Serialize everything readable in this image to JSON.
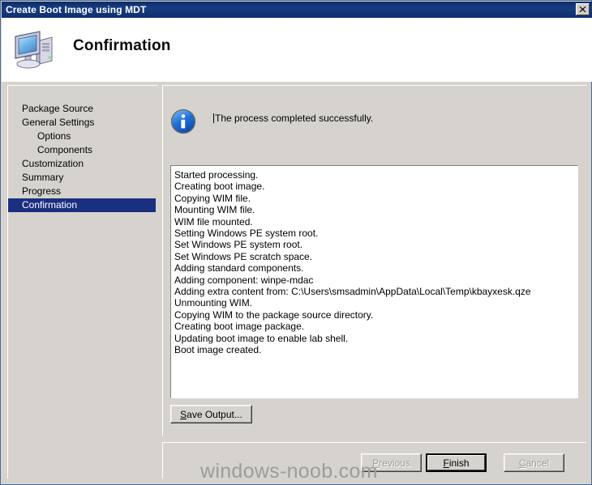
{
  "window": {
    "title": "Create Boot Image using MDT",
    "close_label": "✕"
  },
  "header": {
    "title": "Confirmation",
    "icon": "computer-icon"
  },
  "sidebar": {
    "items": [
      {
        "label": "Package Source",
        "indent": false,
        "selected": false
      },
      {
        "label": "General Settings",
        "indent": false,
        "selected": false
      },
      {
        "label": "Options",
        "indent": true,
        "selected": false
      },
      {
        "label": "Components",
        "indent": true,
        "selected": false
      },
      {
        "label": "Customization",
        "indent": false,
        "selected": false
      },
      {
        "label": "Summary",
        "indent": false,
        "selected": false
      },
      {
        "label": "Progress",
        "indent": false,
        "selected": false
      },
      {
        "label": "Confirmation",
        "indent": false,
        "selected": true
      }
    ]
  },
  "content": {
    "info_icon": "information-icon",
    "info_message": "The process completed successfully.",
    "log_lines": [
      "Started processing.",
      "Creating boot image.",
      "Copying WIM file.",
      "Mounting WIM file.",
      "WIM file mounted.",
      "Setting Windows PE system root.",
      "Set Windows PE system root.",
      "Set Windows PE scratch space.",
      "Adding standard components.",
      "Adding component: winpe-mdac",
      "Adding extra content from: C:\\Users\\smsadmin\\AppData\\Local\\Temp\\kbayxesk.qze",
      "Unmounting WIM.",
      "Copying WIM to the package source directory.",
      "Creating boot image package.",
      "Updating boot image to enable lab shell.",
      "Boot image created."
    ],
    "save_output_accel": "S",
    "save_output_rest": "ave Output..."
  },
  "footer": {
    "previous_accel": "P",
    "previous_rest": "revious",
    "finish_accel": "F",
    "finish_rest": "inish",
    "cancel_accel": "C",
    "cancel_rest": "ancel"
  },
  "watermark": {
    "text": "windows-noob.com"
  },
  "colors": {
    "titlebar": "#163c82",
    "selection": "#1b2f80",
    "face": "#d6d3ce",
    "info_blue": "#1f6fd0",
    "disabled_text": "#9a9a96",
    "watermark": "#9d9d97"
  }
}
